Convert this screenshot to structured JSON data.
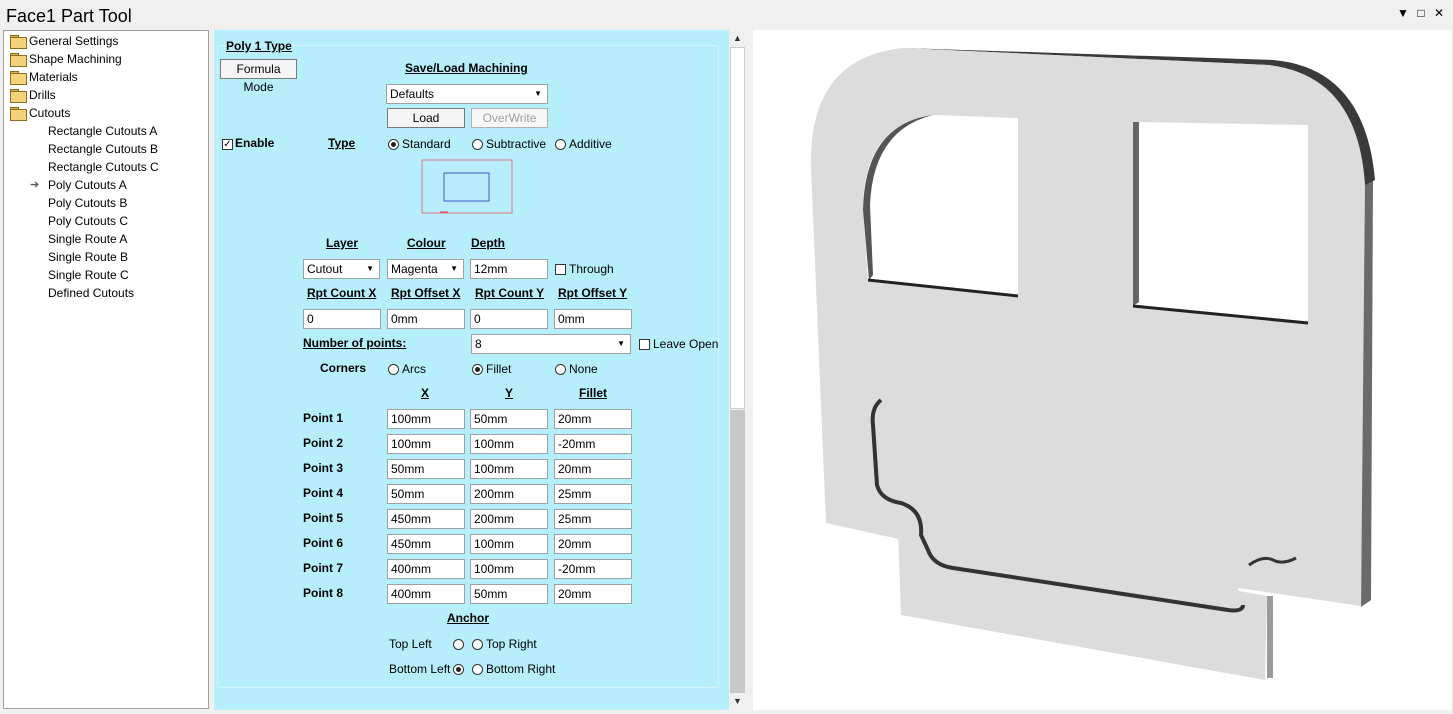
{
  "window": {
    "title": "Face1 Part Tool",
    "controls": [
      "▼",
      "□",
      "✕"
    ]
  },
  "tree": {
    "items": [
      {
        "label": "General Settings",
        "level": 0,
        "icon": "folder-icon"
      },
      {
        "label": "Shape Machining",
        "level": 0,
        "icon": "folder-icon"
      },
      {
        "label": "Materials",
        "level": 0,
        "icon": "folder-icon"
      },
      {
        "label": "Drills",
        "level": 0,
        "icon": "folder-icon"
      },
      {
        "label": "Cutouts",
        "level": 0,
        "icon": "folder-icon"
      },
      {
        "label": "Rectangle Cutouts A",
        "level": 1
      },
      {
        "label": "Rectangle Cutouts B",
        "level": 1
      },
      {
        "label": "Rectangle Cutouts C",
        "level": 1
      },
      {
        "label": "Poly Cutouts A",
        "level": 1,
        "selected": true,
        "icon": "arrow-right-icon"
      },
      {
        "label": "Poly Cutouts B",
        "level": 1
      },
      {
        "label": "Poly Cutouts C",
        "level": 1
      },
      {
        "label": "Single Route A",
        "level": 1
      },
      {
        "label": "Single Route B",
        "level": 1
      },
      {
        "label": "Single Route C",
        "level": 1
      },
      {
        "label": "Defined Cutouts",
        "level": 1
      }
    ]
  },
  "form": {
    "group_title": "Poly 1 Type",
    "formula_mode_label": "Formula Mode",
    "save_load_header": "Save/Load Machining",
    "preset": "Defaults",
    "load_label": "Load",
    "overwrite_label": "OverWrite",
    "enable_label": "Enable",
    "enable_checked": true,
    "type_header": "Type",
    "type_options": [
      "Standard",
      "Subtractive",
      "Additive"
    ],
    "type_selected": "Standard",
    "layer_header": "Layer",
    "colour_header": "Colour",
    "depth_header": "Depth",
    "layer_value": "Cutout",
    "colour_value": "Magenta",
    "depth_value": "12mm",
    "through_label": "Through",
    "through_checked": false,
    "rpt_count_x_header": "Rpt Count X",
    "rpt_offset_x_header": "Rpt Offset X",
    "rpt_count_y_header": "Rpt Count Y",
    "rpt_offset_y_header": "Rpt Offset Y",
    "rpt_count_x": "0",
    "rpt_offset_x": "0mm",
    "rpt_count_y": "0",
    "rpt_offset_y": "0mm",
    "num_points_label": "Number of points:",
    "num_points": "8",
    "leave_open_label": "Leave Open",
    "leave_open_checked": false,
    "corners_label": "Corners",
    "corner_options": [
      "Arcs",
      "Fillet",
      "None"
    ],
    "corner_selected": "Fillet",
    "col_x": "X",
    "col_y": "Y",
    "col_fillet": "Fillet",
    "points": [
      {
        "label": "Point 1",
        "x": "100mm",
        "y": "50mm",
        "fillet": "20mm"
      },
      {
        "label": "Point 2",
        "x": "100mm",
        "y": "100mm",
        "fillet": "-20mm"
      },
      {
        "label": "Point 3",
        "x": "50mm",
        "y": "100mm",
        "fillet": "20mm"
      },
      {
        "label": "Point 4",
        "x": "50mm",
        "y": "200mm",
        "fillet": "25mm"
      },
      {
        "label": "Point 5",
        "x": "450mm",
        "y": "200mm",
        "fillet": "25mm"
      },
      {
        "label": "Point 6",
        "x": "450mm",
        "y": "100mm",
        "fillet": "20mm"
      },
      {
        "label": "Point 7",
        "x": "400mm",
        "y": "100mm",
        "fillet": "-20mm"
      },
      {
        "label": "Point 8",
        "x": "400mm",
        "y": "50mm",
        "fillet": "20mm"
      }
    ],
    "anchor_header": "Anchor",
    "anchor_options": [
      "Top Left",
      "Top Right",
      "Bottom Left",
      "Bottom Right"
    ],
    "anchor_selected": "Bottom Left"
  },
  "colors": {
    "panel_bg": "#b6effb",
    "preview_border": "#e07080",
    "preview_rect": "#3a5fd0",
    "part_face": "#dcdcdc",
    "part_edge": "#3a3a3a"
  }
}
